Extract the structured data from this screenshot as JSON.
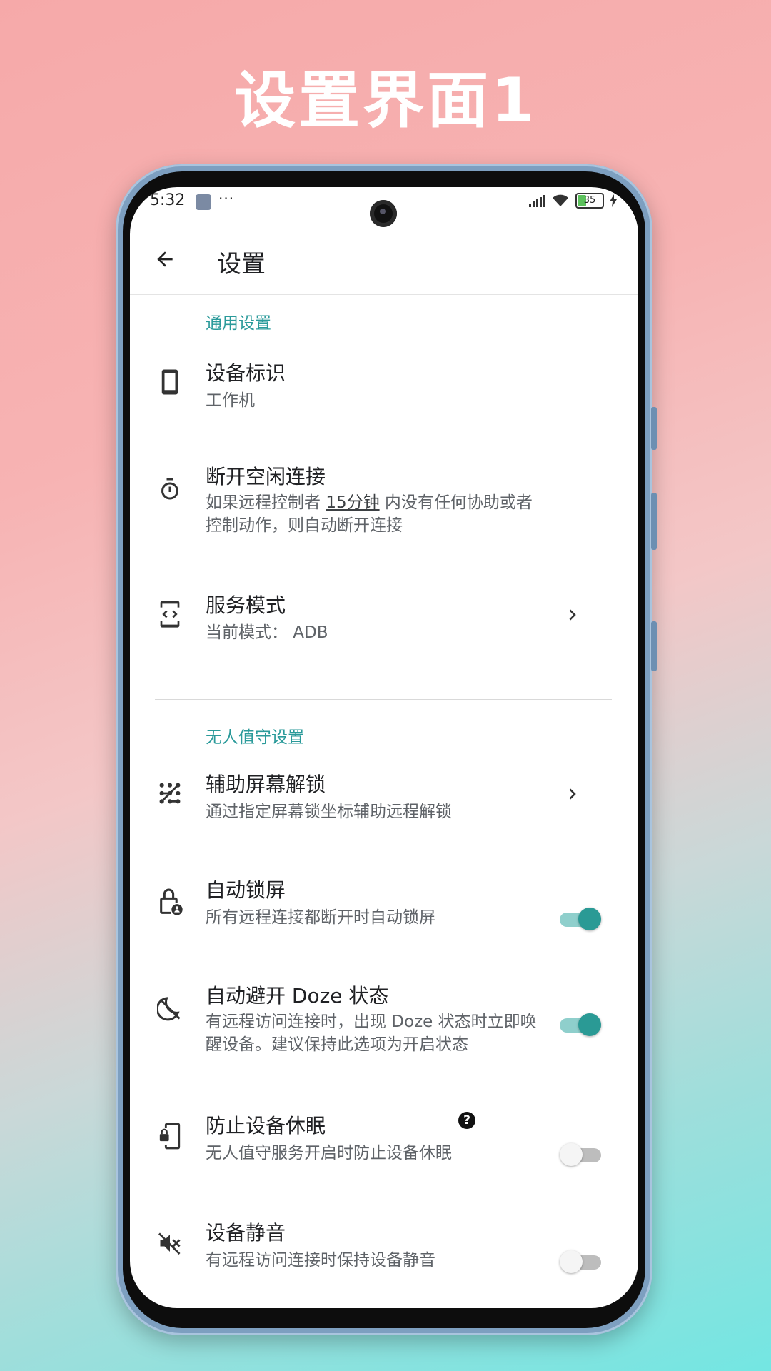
{
  "banner": {
    "title": "设置界面1"
  },
  "status_bar": {
    "time": "5:32",
    "more": "···",
    "battery": "35"
  },
  "toolbar": {
    "title": "设置",
    "back_icon": "arrow-left-icon"
  },
  "sections": {
    "general": {
      "header": "通用设置"
    },
    "unattended": {
      "header": "无人值守设置"
    }
  },
  "items": {
    "device_id": {
      "icon": "phone-icon",
      "title": "设备标识",
      "subtitle": "工作机"
    },
    "idle_disconnect": {
      "icon": "timer-icon",
      "title": "断开空闲连接",
      "sub_before": "如果远程控制者 ",
      "sub_highlight": "15分钟",
      "sub_after": " 内没有任何协助或者控制动作，则自动断开连接"
    },
    "service_mode": {
      "icon": "code-phone-icon",
      "title": "服务模式",
      "subtitle": "当前模式： ADB"
    },
    "screen_unlock": {
      "icon": "pattern-icon",
      "title": "辅助屏幕解锁",
      "subtitle": "通过指定屏幕锁坐标辅助远程解锁"
    },
    "auto_lock": {
      "icon": "lock-person-icon",
      "title": "自动锁屏",
      "subtitle": "所有远程连接都断开时自动锁屏",
      "enabled": true
    },
    "avoid_doze": {
      "icon": "doze-icon",
      "title": "自动避开 Doze 状态",
      "subtitle": "有远程访问连接时，出现 Doze 状态时立即唤醒设备。建议保持此选项为开启状态",
      "enabled": true
    },
    "prevent_sleep": {
      "icon": "phone-lock-icon",
      "title": "防止设备休眠",
      "help": "?",
      "subtitle": "无人值守服务开启时防止设备休眠",
      "enabled": false
    },
    "mute": {
      "icon": "volume-off-icon",
      "title": "设备静音",
      "subtitle": "有远程访问连接时保持设备静音",
      "enabled": false
    }
  }
}
